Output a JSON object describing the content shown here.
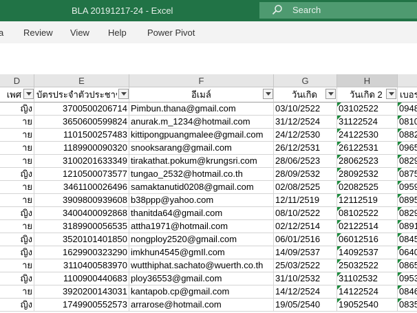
{
  "window": {
    "title": "BLA 20191217-24  -  Excel"
  },
  "search": {
    "label": "Search"
  },
  "ribbon": {
    "tabs": [
      "a",
      "Review",
      "View",
      "Help",
      "Power Pivot"
    ]
  },
  "sheet": {
    "columns": [
      "D",
      "E",
      "F",
      "G",
      "H"
    ],
    "filter_headers": [
      "เพศ",
      "บัตรประจำตัวประชาชน",
      "อีเมล์",
      "วันเกิด",
      "วันเกิด 2",
      "เบอร"
    ],
    "rows": [
      [
        "ญิง",
        "3700500206714",
        "Pimbun.thana@gmail.com",
        "03/10/2522",
        "03102522",
        "0948"
      ],
      [
        "าย",
        "3650600599824",
        "anurak.m_1234@hotmail.com",
        "31/12/2524",
        "31122524",
        "0810"
      ],
      [
        "าย",
        "1101500257483",
        "kittipongpuangmalee@gmail.com",
        "24/12/2530",
        "24122530",
        "0882"
      ],
      [
        "าย",
        "1189900090320",
        "snooksarang@gmail.com",
        "26/12/2531",
        "26122531",
        "0965"
      ],
      [
        "าย",
        "3100201633349",
        "tirakathat.pokum@krungsri.com",
        "28/06/2523",
        "28062523",
        "0829"
      ],
      [
        "ญิง",
        "1210500073577",
        "tungao_2532@hotmail.co.th",
        "28/09/2532",
        "28092532",
        "0875"
      ],
      [
        "าย",
        "3461100026496",
        "samaktanutid0208@gmail.com",
        "02/08/2525",
        "02082525",
        "0959"
      ],
      [
        "าย",
        "3909800939608",
        "b38ppp@yahoo.com",
        "12/11/2519",
        "12112519",
        "0895"
      ],
      [
        "ญิง",
        "3400400092868",
        "thanitda64@gmail.com",
        "08/10/2522",
        "08102522",
        "0829"
      ],
      [
        "าย",
        "3189900056535",
        "attha1971@hotmail.com",
        "02/12/2514",
        "02122514",
        "0891"
      ],
      [
        "ญิง",
        "3520101401850",
        "nongploy2520@gmail.com",
        "06/01/2516",
        "06012516",
        "0845"
      ],
      [
        "ญิง",
        "1629900323290",
        "imkhun4545@gmIl.com",
        "14/09/2537",
        "14092537",
        "0640"
      ],
      [
        "าย",
        "3110400583970",
        "wutthiphat.sachato@wuerth.co.th",
        "25/03/2522",
        "25032522",
        "0865"
      ],
      [
        "ญิง",
        "1100900440683",
        "ploy36553@gmail.com",
        "31/10/2532",
        "31102532",
        "0953"
      ],
      [
        "าย",
        "3920200143031",
        "kantapob.cp@gmail.com",
        "14/12/2524",
        "14122524",
        "0846"
      ],
      [
        "ญิง",
        "1749900552573",
        "arrarose@hotmail.com",
        "19/05/2540",
        "19052540",
        "0835"
      ]
    ]
  }
}
